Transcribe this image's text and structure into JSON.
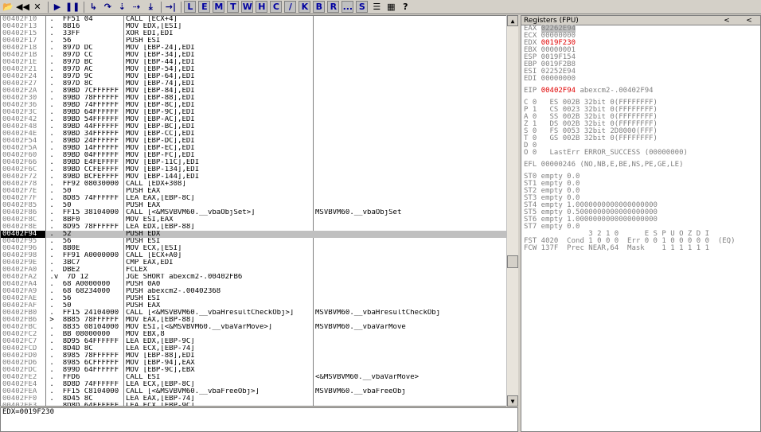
{
  "toolbar": {
    "buttons": [
      {
        "name": "open-icon",
        "glyph": "📂"
      },
      {
        "name": "rewind-icon",
        "glyph": "◀◀"
      },
      {
        "name": "close-icon",
        "glyph": "✕"
      },
      {
        "name": "run-icon",
        "glyph": "▶"
      },
      {
        "name": "pause-icon",
        "glyph": "❚❚"
      },
      {
        "name": "step-into-icon",
        "glyph": "↳"
      },
      {
        "name": "step-over-icon",
        "glyph": "↷"
      },
      {
        "name": "trace-into-icon",
        "glyph": "⇣"
      },
      {
        "name": "trace-over-icon",
        "glyph": "⇢"
      },
      {
        "name": "execute-till-return-icon",
        "glyph": "⤓"
      },
      {
        "name": "goto-icon",
        "glyph": "→|"
      }
    ],
    "letters": [
      "L",
      "E",
      "M",
      "T",
      "W",
      "H",
      "C",
      "/",
      "K",
      "B",
      "R",
      "...",
      "S"
    ],
    "tail_buttons": [
      {
        "name": "list-icon",
        "glyph": "☰"
      },
      {
        "name": "window-icon",
        "glyph": "▦"
      },
      {
        "name": "help-icon",
        "glyph": "?"
      }
    ]
  },
  "disasm": {
    "rows": [
      {
        "addr": "00402F10",
        "mark": " .",
        "hex": "FF51 04",
        "asm": "CALL [ECX+4]",
        "com": ""
      },
      {
        "addr": "00402F13",
        "mark": " .",
        "hex": "8B16",
        "asm": "MOV EDX,[ESI]",
        "com": ""
      },
      {
        "addr": "00402F15",
        "mark": " .",
        "hex": "33FF",
        "asm": "XOR EDI,EDI",
        "com": ""
      },
      {
        "addr": "00402F17",
        "mark": " .",
        "hex": "56",
        "asm": "PUSH ESI",
        "com": ""
      },
      {
        "addr": "00402F18",
        "mark": " .",
        "hex": "897D DC",
        "asm": "MOV [EBP-24],EDI",
        "com": ""
      },
      {
        "addr": "00402F1B",
        "mark": " .",
        "hex": "897D CC",
        "asm": "MOV [EBP-34],EDI",
        "com": ""
      },
      {
        "addr": "00402F1E",
        "mark": " .",
        "hex": "897D BC",
        "asm": "MOV [EBP-44],EDI",
        "com": ""
      },
      {
        "addr": "00402F21",
        "mark": " .",
        "hex": "897D AC",
        "asm": "MOV [EBP-54],EDI",
        "com": ""
      },
      {
        "addr": "00402F24",
        "mark": " .",
        "hex": "897D 9C",
        "asm": "MOV [EBP-64],EDI",
        "com": ""
      },
      {
        "addr": "00402F27",
        "mark": " .",
        "hex": "897D 8C",
        "asm": "MOV [EBP-74],EDI",
        "com": ""
      },
      {
        "addr": "00402F2A",
        "mark": " .",
        "hex": "89BD 7CFFFFFF",
        "asm": "MOV [EBP-84],EDI",
        "com": ""
      },
      {
        "addr": "00402F30",
        "mark": " .",
        "hex": "89BD 78FFFFFF",
        "asm": "MOV [EBP-88],EDI",
        "com": ""
      },
      {
        "addr": "00402F36",
        "mark": " .",
        "hex": "89BD 74FFFFFF",
        "asm": "MOV [EBP-8C],EDI",
        "com": ""
      },
      {
        "addr": "00402F3C",
        "mark": " .",
        "hex": "89BD 64FFFFFF",
        "asm": "MOV [EBP-9C],EDI",
        "com": ""
      },
      {
        "addr": "00402F42",
        "mark": " .",
        "hex": "89BD 54FFFFFF",
        "asm": "MOV [EBP-AC],EDI",
        "com": ""
      },
      {
        "addr": "00402F48",
        "mark": " .",
        "hex": "89BD 44FFFFFF",
        "asm": "MOV [EBP-BC],EDI",
        "com": ""
      },
      {
        "addr": "00402F4E",
        "mark": " .",
        "hex": "89BD 34FFFFFF",
        "asm": "MOV [EBP-CC],EDI",
        "com": ""
      },
      {
        "addr": "00402F54",
        "mark": " .",
        "hex": "89BD 24FFFFFF",
        "asm": "MOV [EBP-DC],EDI",
        "com": ""
      },
      {
        "addr": "00402F5A",
        "mark": " .",
        "hex": "89BD 14FFFFFF",
        "asm": "MOV [EBP-EC],EDI",
        "com": ""
      },
      {
        "addr": "00402F60",
        "mark": " .",
        "hex": "89BD 04FFFFFF",
        "asm": "MOV [EBP-FC],EDI",
        "com": ""
      },
      {
        "addr": "00402F66",
        "mark": " .",
        "hex": "89BD E4FEFFFF",
        "asm": "MOV [EBP-11C],EDI",
        "com": ""
      },
      {
        "addr": "00402F6C",
        "mark": " .",
        "hex": "89BD CCFEFFFF",
        "asm": "MOV [EBP-134],EDI",
        "com": ""
      },
      {
        "addr": "00402F72",
        "mark": " .",
        "hex": "89BD BCFEFFFF",
        "asm": "MOV [EBP-144],EDI",
        "com": ""
      },
      {
        "addr": "00402F78",
        "mark": " .",
        "hex": "FF92 08030000",
        "asm": "CALL [EDX+308]",
        "com": ""
      },
      {
        "addr": "00402F7E",
        "mark": " .",
        "hex": "50",
        "asm": "PUSH EAX",
        "com": ""
      },
      {
        "addr": "00402F7F",
        "mark": " .",
        "hex": "8D85 74FFFFFF",
        "asm": "LEA EAX,[EBP-8C]",
        "com": ""
      },
      {
        "addr": "00402F85",
        "mark": " .",
        "hex": "50",
        "asm": "PUSH EAX",
        "com": ""
      },
      {
        "addr": "00402F86",
        "mark": " .",
        "hex": "FF15 38104000",
        "asm": "CALL [<&MSVBVM60.__vbaObjSet>]",
        "com": "MSVBVM60.__vbaObjSet"
      },
      {
        "addr": "00402F8C",
        "mark": " .",
        "hex": "8BF0",
        "asm": "MOV ESI,EAX",
        "com": ""
      },
      {
        "addr": "00402F8E",
        "mark": " .",
        "hex": "8D95 78FFFFFF",
        "asm": "LEA EDX,[EBP-88]",
        "com": ""
      },
      {
        "addr": "00402F94",
        "mark": " .",
        "hex": "52",
        "asm": "PUSH EDX",
        "com": "",
        "sel": true
      },
      {
        "addr": "00402F95",
        "mark": " .",
        "hex": "56",
        "asm": "PUSH ESI",
        "com": ""
      },
      {
        "addr": "00402F96",
        "mark": " .",
        "hex": "8B0E",
        "asm": "MOV ECX,[ESI]",
        "com": ""
      },
      {
        "addr": "00402F98",
        "mark": " .",
        "hex": "FF91 A0000000",
        "asm": "CALL [ECX+A0]",
        "com": ""
      },
      {
        "addr": "00402F9E",
        "mark": " .",
        "hex": "3BC7",
        "asm": "CMP EAX,EDI",
        "com": ""
      },
      {
        "addr": "00402FA0",
        "mark": " .",
        "hex": "DBE2",
        "asm": "FCLEX",
        "com": ""
      },
      {
        "addr": "00402FA2",
        "mark": " .v",
        "hex": "7D 12",
        "asm": "JGE SHORT abexcm2-.00402FB6",
        "com": ""
      },
      {
        "addr": "00402FA4",
        "mark": " .",
        "hex": "68 A0000000",
        "asm": "PUSH 0A0",
        "com": ""
      },
      {
        "addr": "00402FA9",
        "mark": " .",
        "hex": "68 68234000",
        "asm": "PUSH abexcm2-.00402368",
        "com": ""
      },
      {
        "addr": "00402FAE",
        "mark": " .",
        "hex": "56",
        "asm": "PUSH ESI",
        "com": ""
      },
      {
        "addr": "00402FAF",
        "mark": " .",
        "hex": "50",
        "asm": "PUSH EAX",
        "com": ""
      },
      {
        "addr": "00402FB0",
        "mark": " .",
        "hex": "FF15 24104000",
        "asm": "CALL [<&MSVBVM60.__vbaHresultCheckObj>]",
        "com": "MSVBVM60.__vbaHresultCheckObj"
      },
      {
        "addr": "00402FB6",
        "mark": " >",
        "hex": "8B85 78FFFFFF",
        "asm": "MOV EAX,[EBP-88]",
        "com": ""
      },
      {
        "addr": "00402FBC",
        "mark": " .",
        "hex": "8B35 08104000",
        "asm": "MOV ESI,[<&MSVBVM60.__vbaVarMove>]",
        "com": "MSVBVM60.__vbaVarMove"
      },
      {
        "addr": "00402FC2",
        "mark": " .",
        "hex": "BB 08000000",
        "asm": "MOV EBX,8",
        "com": ""
      },
      {
        "addr": "00402FC7",
        "mark": " .",
        "hex": "8D95 64FFFFFF",
        "asm": "LEA EDX,[EBP-9C]",
        "com": ""
      },
      {
        "addr": "00402FCD",
        "mark": " .",
        "hex": "8D4D 8C",
        "asm": "LEA ECX,[EBP-74]",
        "com": ""
      },
      {
        "addr": "00402FD0",
        "mark": " .",
        "hex": "8985 78FFFFFF",
        "asm": "MOV [EBP-88],EDI",
        "com": ""
      },
      {
        "addr": "00402FD6",
        "mark": " .",
        "hex": "8985 6CFFFFFF",
        "asm": "MOV [EBP-94],EAX",
        "com": ""
      },
      {
        "addr": "00402FDC",
        "mark": " .",
        "hex": "899D 64FFFFFF",
        "asm": "MOV [EBP-9C],EBX",
        "com": ""
      },
      {
        "addr": "00402FE2",
        "mark": " .",
        "hex": "FFD6",
        "asm": "CALL ESI",
        "com": "<&MSVBVM60.__vbaVarMove>"
      },
      {
        "addr": "00402FE4",
        "mark": " .",
        "hex": "8D8D 74FFFFFF",
        "asm": "LEA ECX,[EBP-8C]",
        "com": ""
      },
      {
        "addr": "00402FEA",
        "mark": " .",
        "hex": "FF15 C8104000",
        "asm": "CALL [<&MSVBVM60.__vbaFreeObj>]",
        "com": "MSVBVM60.__vbaFreeObj"
      },
      {
        "addr": "00402FF0",
        "mark": " .",
        "hex": "8D45 8C",
        "asm": "LEA EAX,[EBP-74]",
        "com": ""
      },
      {
        "addr": "00402FF3",
        "mark": " .",
        "hex": "8D8D 64FFFFFF",
        "asm": "LEA ECX,[EBP-9C]",
        "com": ""
      }
    ]
  },
  "infoline": "EDX=0019F230",
  "registers": {
    "title": "Registers (FPU)",
    "lines": [
      {
        "t": "EAX ",
        "v": "02262E94",
        "cls": "hl"
      },
      {
        "t": "ECX 00000000"
      },
      {
        "t": "EDX ",
        "v": "0019F230",
        "cls": "red"
      },
      {
        "t": "EBX 00000001"
      },
      {
        "t": "ESP 0019F154"
      },
      {
        "t": "EBP 0019F2B8"
      },
      {
        "t": "ESI 02252E94"
      },
      {
        "t": "EDI 00000000"
      },
      {
        "gap": true
      },
      {
        "t": "EIP ",
        "v": "00402F94",
        "cls": "red",
        "rest": " abexcm2-.00402F94"
      },
      {
        "gap": true
      },
      {
        "t": "C 0   ES 002B 32bit 0(FFFFFFFF)"
      },
      {
        "t": "P 1   CS 0023 32bit 0(FFFFFFFF)"
      },
      {
        "t": "A 0   SS 002B 32bit 0(FFFFFFFF)"
      },
      {
        "t": "Z 1   DS 002B 32bit 0(FFFFFFFF)"
      },
      {
        "t": "S 0   FS 0053 32bit 2D8000(FFF)"
      },
      {
        "t": "T 0   GS 002B 32bit 0(FFFFFFFF)"
      },
      {
        "t": "D 0"
      },
      {
        "t": "O 0   LastErr ERROR_SUCCESS (00000000)"
      },
      {
        "gap": true
      },
      {
        "t": "EFL 00000246 (NO,NB,E,BE,NS,PE,GE,LE)"
      },
      {
        "gap": true
      },
      {
        "t": "ST0 empty 0.0"
      },
      {
        "t": "ST1 empty 0.0"
      },
      {
        "t": "ST2 empty 0.0"
      },
      {
        "t": "ST3 empty 0.0"
      },
      {
        "t": "ST4 empty 1.0000000000000000000"
      },
      {
        "t": "ST5 empty 0.5000000000000000000"
      },
      {
        "t": "ST6 empty 1.0000000000000000000"
      },
      {
        "t": "ST7 empty 0.0"
      },
      {
        "t": "               3 2 1 0      E S P U O Z D I"
      },
      {
        "t": "FST 4020  Cond 1 0 0 0  Err 0 0 1 0 0 0 0 0  (EQ)"
      },
      {
        "t": "FCW 137F  Prec NEAR,64  Mask    1 1 1 1 1 1"
      }
    ]
  }
}
